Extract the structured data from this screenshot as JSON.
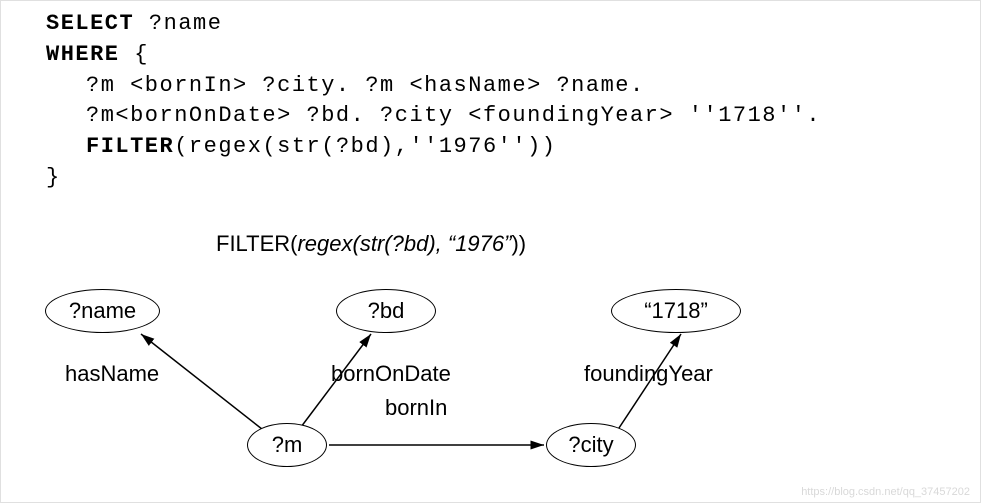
{
  "code": {
    "select_kw": "SELECT",
    "select_vars": " ?name",
    "where_kw": "WHERE",
    "brace_open": " {",
    "line1": "?m <bornIn> ?city.  ?m <hasName> ?name.",
    "line2": "?m<bornOnDate> ?bd.  ?city <foundingYear> ''1718''.",
    "filter_kw": "FILTER",
    "filter_rest": "(regex(str(?bd),''1976''))",
    "brace_close": "}"
  },
  "filter_label": {
    "prefix": "FILTER(",
    "args": "regex(str(?bd), “1976”",
    "suffix": "))"
  },
  "nodes": {
    "name": "?name",
    "bd": "?bd",
    "y1718": "“1718”",
    "m": "?m",
    "city": "?city"
  },
  "edges": {
    "hasName": "hasName",
    "bornOnDate": "bornOnDate",
    "bornIn": "bornIn",
    "foundingYear": "foundingYear"
  },
  "watermark": "https://blog.csdn.net/qq_37457202",
  "chart_data": {
    "type": "diagram",
    "title": "SPARQL query and its query graph",
    "query_text": "SELECT ?name WHERE { ?m <bornIn> ?city. ?m <hasName> ?name. ?m<bornOnDate> ?bd. ?city <foundingYear> ''1718''. FILTER(regex(str(?bd),''1976'')) }",
    "filter_annotation": "FILTER(regex(str(?bd), “1976”))",
    "graph": {
      "nodes": [
        {
          "id": "?name",
          "kind": "variable"
        },
        {
          "id": "?bd",
          "kind": "variable"
        },
        {
          "id": "“1718”",
          "kind": "literal"
        },
        {
          "id": "?m",
          "kind": "variable"
        },
        {
          "id": "?city",
          "kind": "variable"
        }
      ],
      "edges": [
        {
          "from": "?m",
          "to": "?name",
          "label": "hasName"
        },
        {
          "from": "?m",
          "to": "?bd",
          "label": "bornOnDate"
        },
        {
          "from": "?m",
          "to": "?city",
          "label": "bornIn"
        },
        {
          "from": "?city",
          "to": "“1718”",
          "label": "foundingYear"
        }
      ]
    }
  }
}
